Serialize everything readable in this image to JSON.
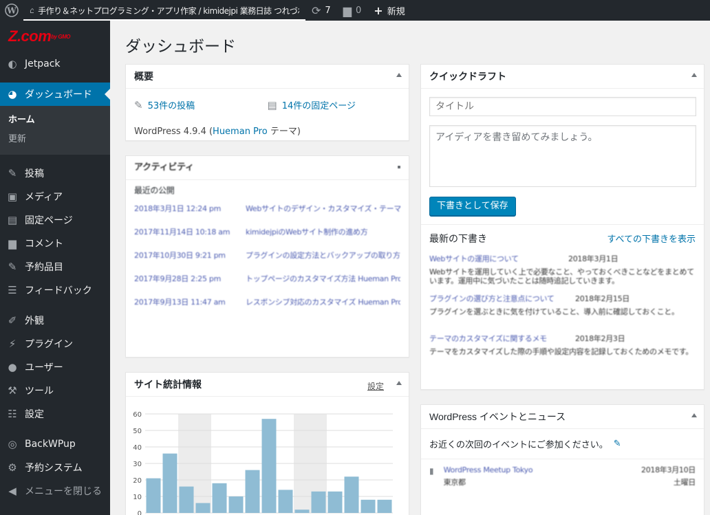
{
  "admin_bar": {
    "site_name": "手作り＆ネットプログラミング・アプリ作家 / kimidejpi 業務日誌 つれづれ・手帳日記",
    "updates_count": "7",
    "comments_count": "0",
    "new_label": "新規"
  },
  "sidebar": {
    "brand": "Z.com",
    "brand_suffix": "by GMO",
    "items": [
      {
        "label": "Jetpack",
        "icon": "jetpack-icon"
      },
      {
        "label": "ダッシュボード",
        "icon": "dashboard-icon"
      },
      {
        "label": "投稿",
        "icon": "pin-icon"
      },
      {
        "label": "メディア",
        "icon": "media-icon"
      },
      {
        "label": "固定ページ",
        "icon": "page-icon"
      },
      {
        "label": "コメント",
        "icon": "comment-icon"
      },
      {
        "label": "予約品目",
        "icon": "pin-icon"
      },
      {
        "label": "フィードバック",
        "icon": "feedback-icon"
      },
      {
        "label": "外観",
        "icon": "brush-icon"
      },
      {
        "label": "プラグイン",
        "icon": "plugin-icon"
      },
      {
        "label": "ユーザー",
        "icon": "user-icon"
      },
      {
        "label": "ツール",
        "icon": "wrench-icon"
      },
      {
        "label": "設定",
        "icon": "settings-icon"
      },
      {
        "label": "BackWPup",
        "icon": "backwpup-icon"
      },
      {
        "label": "予約システム",
        "icon": "gear-icon"
      },
      {
        "label": "メニューを閉じる",
        "icon": "collapse-icon"
      }
    ],
    "submenu": {
      "home": "ホーム",
      "updates": "更新"
    }
  },
  "page_title": "ダッシュボード",
  "at_a_glance": {
    "title": "概要",
    "posts": "53件の投稿",
    "pages": "14件の固定ページ",
    "version_prefix": "WordPress 4.9.4 (",
    "theme": "Hueman Pro",
    "version_suffix": " テーマ)"
  },
  "activity": {
    "title": "アクティビティ",
    "section": "最近の公開",
    "rows": [
      {
        "date": "2018年3月1日 12:24 pm",
        "title": "Webサイトのデザイン・カスタマイズ・テーマ関連の情報まとめ"
      },
      {
        "date": "2017年11月14日 10:18 am",
        "title": "kimidejpiのWebサイト制作の進め方"
      },
      {
        "date": "2017年10月30日 9:21 pm",
        "title": "プラグインの設定方法とバックアップの取り方まとめ"
      },
      {
        "date": "2017年9月28日 2:25 pm",
        "title": "トップページのカスタマイズ方法 Hueman Pro"
      },
      {
        "date": "2017年9月13日 11:47 am",
        "title": "レスポンシブ対応のカスタマイズ Hueman Pro"
      }
    ]
  },
  "stats": {
    "title": "サイト統計情報",
    "settings_label": "設定"
  },
  "chart_data": {
    "type": "bar",
    "title": "",
    "xlabel": "",
    "ylabel": "",
    "ylim": [
      0,
      60
    ],
    "yticks": [
      0,
      10,
      20,
      30,
      40,
      50,
      60
    ],
    "values": [
      21,
      36,
      16,
      6,
      18,
      10,
      26,
      57,
      14,
      2,
      13,
      13,
      22,
      8,
      8
    ],
    "color": "#8fbcd4",
    "shaded_bands": [
      [
        2,
        3
      ],
      [
        9,
        10
      ]
    ]
  },
  "quick_draft": {
    "title": "クイックドラフト",
    "title_placeholder": "タイトル",
    "content_placeholder": "アイディアを書き留めてみましょう。",
    "save_button": "下書きとして保存",
    "recent_label": "最新の下書き",
    "view_all": "すべての下書きを表示",
    "drafts": [
      {
        "title": "Webサイトの運用について",
        "date": "2018年3月1日",
        "excerpt": "Webサイトを運用していく上で必要なこと、やっておくべきことなどをまとめています。運用中に気づいたことは随時追記していきます。"
      },
      {
        "title": "プラグインの選び方と注意点について",
        "date": "2018年2月15日",
        "excerpt": "プラグインを選ぶときに気を付けていること、導入前に確認しておくこと。"
      },
      {
        "title": "テーマのカスタマイズに関するメモ",
        "date": "2018年2月3日",
        "excerpt": "テーマをカスタマイズした際の手順や設定内容を記録しておくためのメモです。"
      }
    ]
  },
  "events": {
    "title": "WordPress イベントとニュース",
    "intro": "お近くの次回のイベントにご参加ください。",
    "event_title": "WordPress Meetup Tokyo",
    "event_place": "東京都",
    "event_date": "2018年3月10日",
    "event_time": "土曜日"
  }
}
